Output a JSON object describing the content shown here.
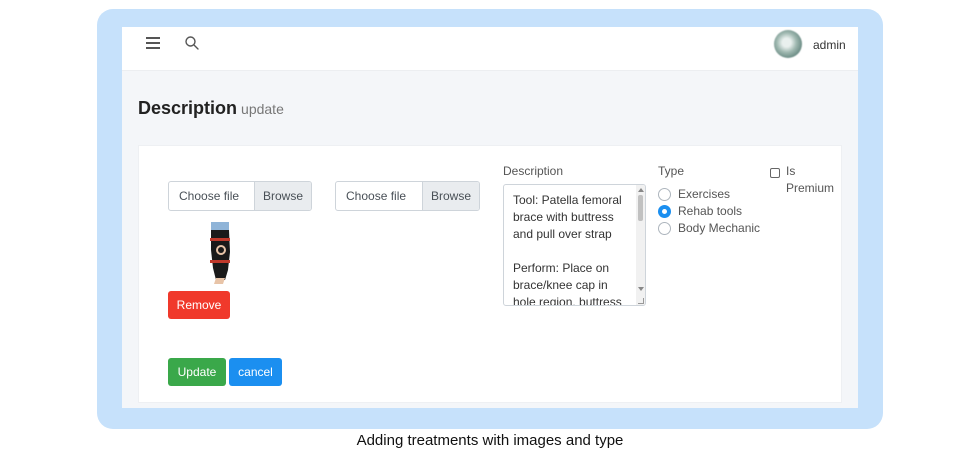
{
  "navbar": {
    "user_name": "admin",
    "icons": [
      "hamburger-menu-icon",
      "search-icon",
      "user-avatar"
    ]
  },
  "page": {
    "title": "Description",
    "subtitle": "update"
  },
  "form": {
    "file_inputs": [
      {
        "choose_label": "Choose file",
        "browse_label": "Browse"
      },
      {
        "choose_label": "Choose file",
        "browse_label": "Browse"
      }
    ],
    "remove_label": "Remove",
    "description": {
      "label": "Description",
      "value": "Tool: Patella femoral brace with buttress and pull over strap\n\nPerform: Place on brace/knee cap in hole region, buttress"
    },
    "type": {
      "label": "Type",
      "options": [
        "Exercises",
        "Rehab tools",
        "Body Mechanic"
      ],
      "selected": "Rehab tools"
    },
    "premium": {
      "label_line1": "Is",
      "label_line2": "Premium",
      "checked": false
    },
    "update_label": "Update",
    "cancel_label": "cancel"
  },
  "caption": "Adding treatments with images and type",
  "colors": {
    "frame": "#c6e1fb",
    "remove": "#f0392b",
    "update": "#3aa84a",
    "cancel": "#1b8ff0",
    "radio_selected": "#1b8ff0"
  }
}
